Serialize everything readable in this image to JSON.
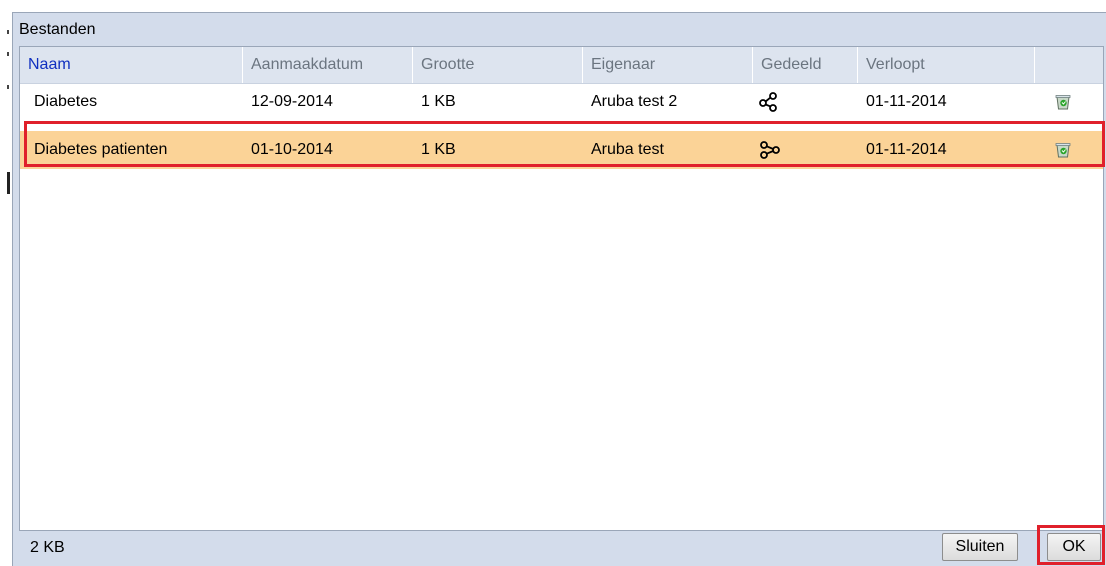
{
  "dialog": {
    "title": "Bestanden",
    "columns": [
      "Naam",
      "Aanmaakdatum",
      "Grootte",
      "Eigenaar",
      "Gedeeld",
      "Verloopt",
      ""
    ],
    "rows": [
      {
        "name": "Diabetes",
        "created": "12-09-2014",
        "size": "1 KB",
        "owner": "Aruba test 2",
        "shared_icon": "share-icon",
        "expires": "01-11-2014",
        "action_icon": "recycle-bin-icon",
        "selected": false
      },
      {
        "name": "Diabetes patienten",
        "created": "01-10-2014",
        "size": "1 KB",
        "owner": "Aruba test",
        "shared_icon": "shared-link-icon",
        "expires": "01-11-2014",
        "action_icon": "recycle-bin-icon",
        "selected": true
      }
    ],
    "footer": {
      "total_size": "2 KB",
      "close_label": "Sluiten",
      "ok_label": "OK"
    }
  },
  "colors": {
    "header_bg": "#dde4ef",
    "dialog_bg": "#d3dceb",
    "selected_row": "#fbd397",
    "highlight": "#e0202b",
    "active_header": "#1030c0"
  }
}
